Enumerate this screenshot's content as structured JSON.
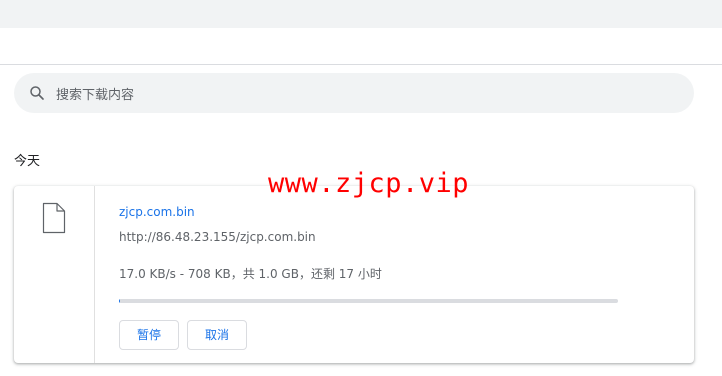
{
  "search": {
    "placeholder": "搜索下载内容",
    "icon": "search-icon"
  },
  "section": {
    "title": "今天"
  },
  "download": {
    "filename": "zjcp.com.bin",
    "url": "http://86.48.23.155/zjcp.com.bin",
    "status": "17.0 KB/s - 708 KB，共 1.0 GB，还剩 17 小时",
    "progress": 0.0007,
    "pause_label": "暂停",
    "cancel_label": "取消",
    "icon": "file-icon"
  },
  "watermark": "www.zjcp.vip",
  "colors": {
    "accent": "#1a73e8",
    "watermark": "#ff0000",
    "searchbar": "#f1f3f4"
  }
}
